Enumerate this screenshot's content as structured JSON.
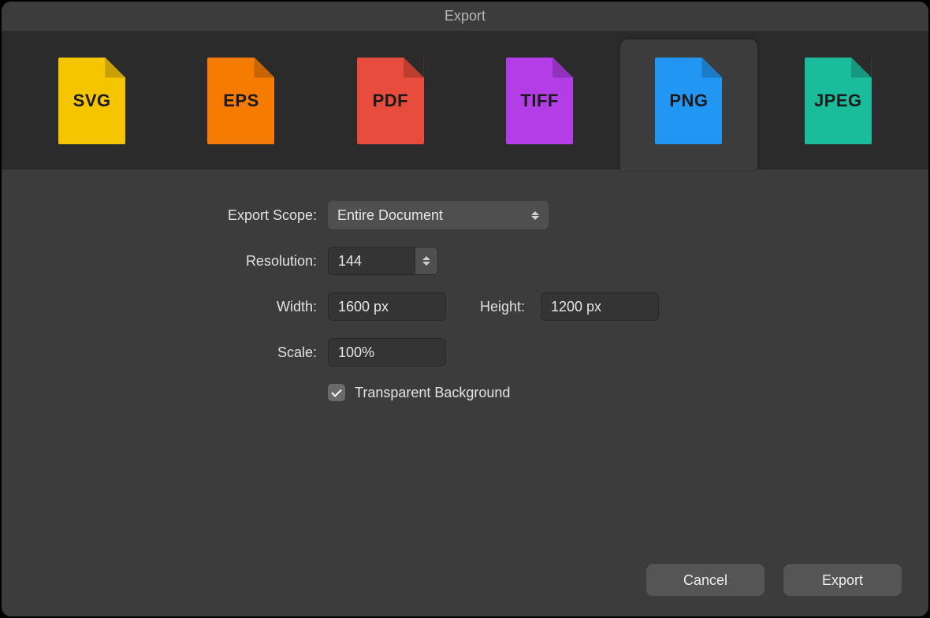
{
  "window": {
    "title": "Export"
  },
  "formats": [
    {
      "label": "SVG",
      "color": "#f5c600"
    },
    {
      "label": "EPS",
      "color": "#f57c00"
    },
    {
      "label": "PDF",
      "color": "#e74c3c"
    },
    {
      "label": "TIFF",
      "color": "#b33de6"
    },
    {
      "label": "PNG",
      "color": "#2196f3"
    },
    {
      "label": "JPEG",
      "color": "#1abc9c"
    }
  ],
  "selected_format_index": 4,
  "form": {
    "export_scope": {
      "label": "Export Scope:",
      "value": "Entire Document"
    },
    "resolution": {
      "label": "Resolution:",
      "value": "144"
    },
    "width": {
      "label": "Width:",
      "value": "1600 px"
    },
    "height": {
      "label": "Height:",
      "value": "1200 px"
    },
    "scale": {
      "label": "Scale:",
      "value": "100%"
    },
    "transparent_bg": {
      "label": "Transparent Background",
      "checked": true
    }
  },
  "buttons": {
    "cancel": "Cancel",
    "export": "Export"
  }
}
